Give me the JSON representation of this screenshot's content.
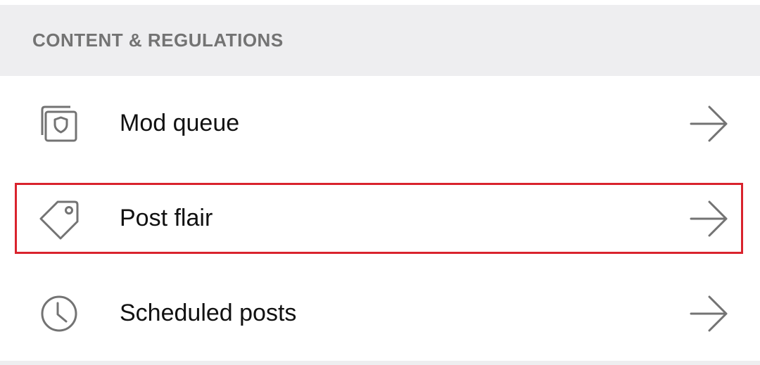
{
  "section": {
    "title": "CONTENT & REGULATIONS"
  },
  "items": [
    {
      "label": "Mod queue",
      "icon": "mod-queue-icon"
    },
    {
      "label": "Post flair",
      "icon": "tag-icon"
    },
    {
      "label": "Scheduled posts",
      "icon": "clock-icon"
    }
  ],
  "colors": {
    "section_bg": "#eeeef0",
    "section_text": "#737373",
    "icon_stroke": "#737373",
    "highlight_border": "#d9232d"
  }
}
